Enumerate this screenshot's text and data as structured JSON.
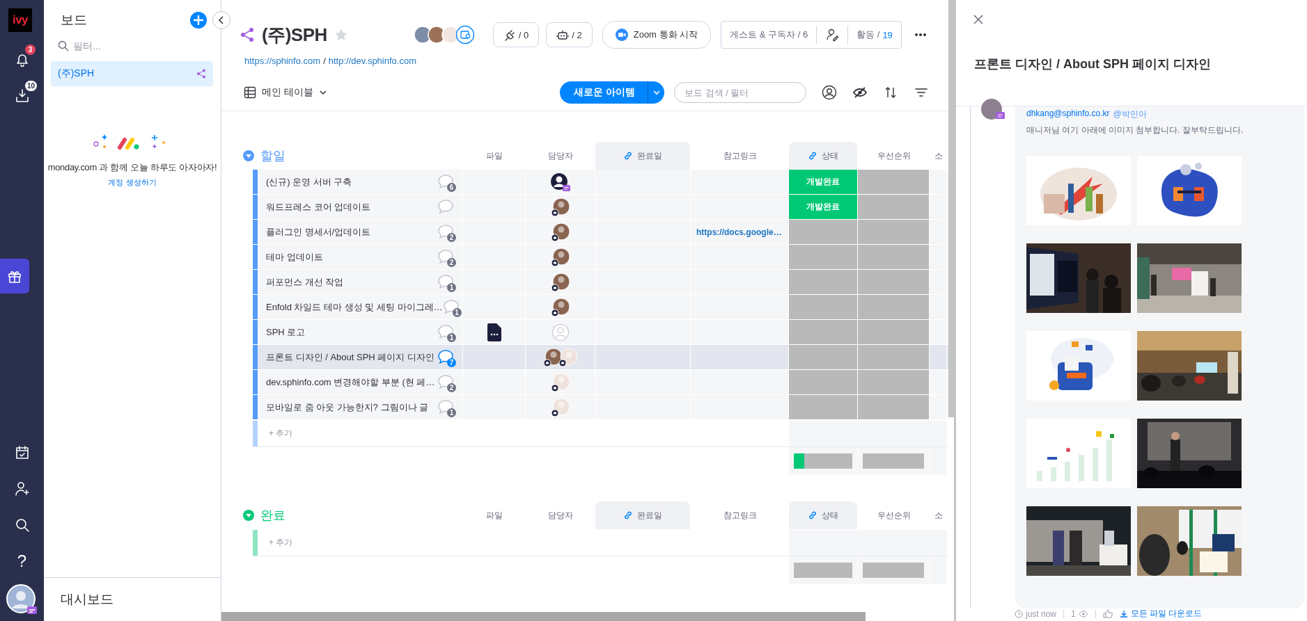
{
  "nav": {
    "logo": "ivy",
    "top_items": [
      {
        "kind": "bell",
        "selected": false,
        "badge": {
          "text": "3",
          "color": "#e2445c"
        }
      },
      {
        "kind": "inbox",
        "selected": false,
        "badge": {
          "text": "10",
          "color": "#ffffff"
        }
      }
    ],
    "middle_items": [
      {
        "kind": "gift",
        "selected": true
      }
    ],
    "bottom_items": [
      {
        "kind": "calendar",
        "selected": false
      },
      {
        "kind": "invite",
        "selected": false
      },
      {
        "kind": "search",
        "selected": false
      },
      {
        "kind": "help",
        "label": "?",
        "selected": false
      }
    ]
  },
  "sidebar": {
    "title": "보드",
    "filter_placeholder": "필터...",
    "boards": [
      {
        "name": "(주)SPH",
        "selected": true
      }
    ],
    "promo_text": "monday.com 과 함께 오늘 하루도 아자아자!",
    "promo_link": "계정 생성하기",
    "footer": "대시보드"
  },
  "board": {
    "title": "(주)SPH",
    "starred": false,
    "links": [
      "https://sphinfo.com",
      "/",
      "http://dev.sphinfo.com"
    ],
    "pills": [
      {
        "kind": "integrations",
        "count": "/ 0"
      },
      {
        "kind": "automations",
        "count": "/ 2"
      }
    ],
    "zoom_button": "Zoom 통화 시작",
    "guests": "게스트 & 구독자 / 6",
    "activity_label": "활동 /",
    "activity_count": "19",
    "view": "메인 테이블",
    "new_item": "새로운 아이템",
    "search_placeholder": "보드 검색 / 필터"
  },
  "groups": [
    {
      "title": "할일",
      "color": "#579bfc",
      "expanded": true,
      "columns": [
        {
          "label": "파일",
          "linked": false
        },
        {
          "label": "담당자",
          "linked": false
        },
        {
          "label": "완료일",
          "linked": true
        },
        {
          "label": "참고링크",
          "linked": false
        },
        {
          "label": "상태",
          "linked": true
        },
        {
          "label": "우선순위",
          "linked": false
        },
        {
          "label": "소",
          "linked": false
        }
      ],
      "rows": [
        {
          "name": "(신규) 운영 서버 구축",
          "comments": "6",
          "selected": false,
          "file": false,
          "people": [
            {
              "kind": "guest"
            }
          ],
          "status": {
            "label": "개발완료",
            "color": "#00c875"
          }
        },
        {
          "name": "워드프레스 코어 업데이트",
          "selected": false,
          "file": false,
          "people": [
            {
              "kind": "member",
              "color": "#8a6450"
            }
          ],
          "status": {
            "label": "개발완료",
            "color": "#00c875"
          }
        },
        {
          "name": "플러그인 명세서/업데이트",
          "comments": "2",
          "selected": false,
          "file": false,
          "people": [
            {
              "kind": "member",
              "color": "#8a6450"
            }
          ],
          "link": "https://docs.google…",
          "status": {
            "color": "#b9b9b9"
          }
        },
        {
          "name": "테마 업데이트",
          "comments": "2",
          "selected": false,
          "file": false,
          "people": [
            {
              "kind": "member",
              "color": "#8a6450"
            }
          ],
          "status": {
            "color": "#b9b9b9"
          }
        },
        {
          "name": "퍼포먼스 개선 작업",
          "comments": "1",
          "selected": false,
          "file": false,
          "people": [
            {
              "kind": "member",
              "color": "#8a6450"
            }
          ],
          "status": {
            "color": "#b9b9b9"
          }
        },
        {
          "name": "Enfold 차일드 테마 생성 및 세팅 마이그레…",
          "comments": "1",
          "selected": false,
          "file": false,
          "people": [
            {
              "kind": "member",
              "color": "#8a6450"
            }
          ],
          "status": {
            "color": "#b9b9b9"
          }
        },
        {
          "name": "SPH 로고",
          "comments": "1",
          "selected": false,
          "file": true,
          "people": [
            {
              "kind": "empty"
            }
          ],
          "status": {
            "color": "#b9b9b9"
          }
        },
        {
          "name": "프론트 디자인 / About SPH 페이지 디자인",
          "comments": "7",
          "selected": true,
          "file": false,
          "people": [
            {
              "kind": "member",
              "color": "#8a6450"
            },
            {
              "kind": "member",
              "color": "#efe2dc"
            }
          ],
          "status": {
            "color": "#b9b9b9"
          }
        },
        {
          "name": "dev.sphinfo.com 변경해야할 부분 (현 페…",
          "comments": "2",
          "selected": false,
          "file": false,
          "people": [
            {
              "kind": "member",
              "color": "#efe2dc"
            }
          ],
          "status": {
            "color": "#b9b9b9"
          }
        },
        {
          "name": "모바일로 줌 아웃 가능한지? 그림이나 글",
          "comments": "1",
          "selected": false,
          "file": false,
          "people": [
            {
              "kind": "member",
              "color": "#efe2dc"
            }
          ],
          "status": {
            "color": "#b9b9b9"
          }
        }
      ],
      "add_label": "+ 추가",
      "summary": {
        "level": 0.18,
        "color": "#00c875"
      }
    },
    {
      "title": "완료",
      "color": "#00c875",
      "expanded": true,
      "columns": [
        {
          "label": "파일",
          "linked": false
        },
        {
          "label": "담당자",
          "linked": false
        },
        {
          "label": "완료일",
          "linked": true
        },
        {
          "label": "참고링크",
          "linked": false
        },
        {
          "label": "상태",
          "linked": true
        },
        {
          "label": "우선순위",
          "linked": false
        },
        {
          "label": "소",
          "linked": false
        }
      ],
      "add_label": "+ 추가"
    }
  ],
  "panel": {
    "title": "프론트 디자인 / About SPH 페이지 디자인",
    "author": "dhkang@sphinfo.co.kr",
    "mention": "@박민아",
    "message": "매니저님 여기 아래에 이미지 첨부합니다. 잘부탁드립니다.",
    "time": "just now",
    "seen": "1",
    "download": "모든 파일 다운로드"
  }
}
